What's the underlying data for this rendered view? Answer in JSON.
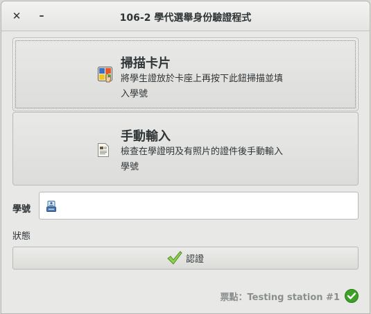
{
  "window": {
    "title": "106-2 學代選舉身份驗證程式",
    "close_glyph": "✕",
    "minimize_glyph": "–"
  },
  "scan_card": {
    "title": "掃描卡片",
    "description": "將學生證放於卡座上再按下此鈕掃描並填入學號",
    "icon": "card-scan-icon"
  },
  "manual_input": {
    "title": "手動輸入",
    "description": "檢查在學證明及有照片的證件後手動輸入學號",
    "icon": "document-icon"
  },
  "student_id": {
    "label": "學號",
    "value": "",
    "icon": "id-field-icon"
  },
  "status": {
    "label": "狀態"
  },
  "verify_button": {
    "label": "認證",
    "icon": "checkmark-icon"
  },
  "footer": {
    "station_text": "票點：Testing station #1",
    "status_icon": "check-circle-icon",
    "status_color": "#3ea027"
  }
}
